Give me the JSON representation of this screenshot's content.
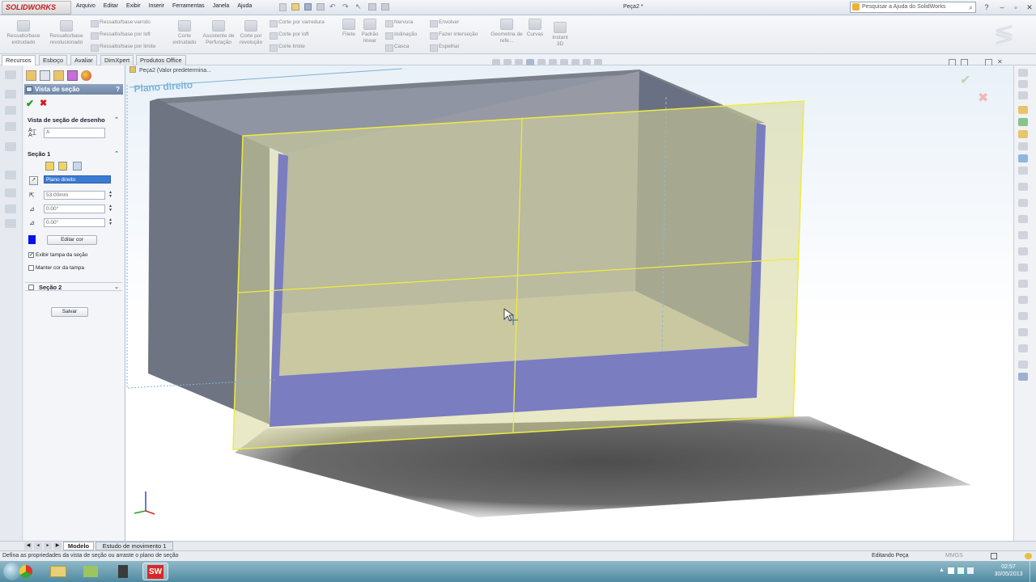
{
  "app": {
    "logo_text": "SOLIDWORKS",
    "document_title": "Peça2 *",
    "help_search_placeholder": "Pesquisar a Ajuda do SolidWorks"
  },
  "menu": [
    "Arquivo",
    "Editar",
    "Exibir",
    "Inserir",
    "Ferramentas",
    "Janela",
    "Ajuda"
  ],
  "ribbon": {
    "big": [
      {
        "label": "Ressalto/base extrudado"
      },
      {
        "label": "Ressalto/base revolucionado"
      },
      {
        "label": "Corte extrudado"
      },
      {
        "label": "Assistente de Perfuração"
      },
      {
        "label": "Corte por revolução"
      },
      {
        "label": "Filete"
      },
      {
        "label": "Padrão linear"
      },
      {
        "label": "Geometria de refe..."
      },
      {
        "label": "Curvas"
      },
      {
        "label": "Instant 3D"
      }
    ],
    "small": [
      "Ressalto/base varrido",
      "Ressalto/base por loft",
      "Ressalto/base por limite",
      "Corte por varredura",
      "Corte por loft",
      "Corte limite",
      "Nervura",
      "Indinação",
      "Casca",
      "Envolver",
      "Fazer interseção",
      "Espelhar"
    ]
  },
  "tabs": [
    "Recursos",
    "Esboço",
    "Avaliar",
    "DimXpert",
    "Produtos Office"
  ],
  "feature_tree": {
    "root": "Peça2  (Valor predetermina..."
  },
  "plane_label": "Plano direito",
  "property_manager": {
    "title": "Vista de seção",
    "help": "?",
    "group1_title": "Vista de seção de desenho",
    "section_name": "A",
    "group2_title": "Seção 1",
    "reference_plane": "Plano direito",
    "offset": "53.00mm",
    "angle1": "0.00°",
    "angle2": "0.00°",
    "edit_color_label": "Editar cor",
    "show_cap_label": "Exibir tampa da seção",
    "show_cap_checked": true,
    "keep_cap_color_label": "Manter cor da tampa",
    "keep_cap_color_checked": false,
    "group3_title": "Seção 2",
    "save_label": "Salvar"
  },
  "bottom_tabs": [
    "Modelo",
    "Estudo de movimento 1"
  ],
  "status": {
    "message": "Defina as propriedades da vista de seção ou arraste o plano de seção",
    "mode": "Editando Peça",
    "units": "MMGS"
  },
  "clock": {
    "time": "02:57",
    "date": "30/05/2013"
  },
  "colors": {
    "section_cap": "#0a10ee",
    "plane_fill": "#d7d79a",
    "plane_edge": "#ecec40",
    "model_gray": "#6e7482"
  }
}
